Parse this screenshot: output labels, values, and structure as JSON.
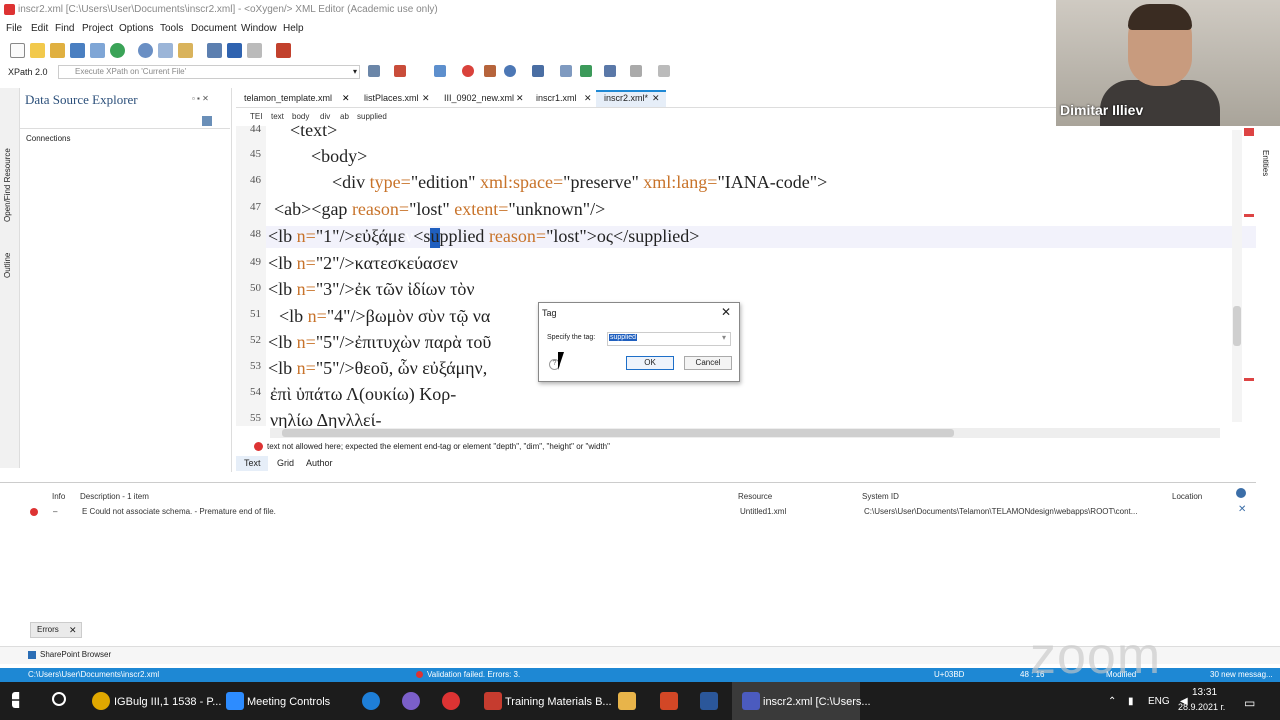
{
  "window": {
    "title": "inscr2.xml [C:\\Users\\User\\Documents\\inscr2.xml] - <oXygen/> XML Editor (Academic use only)"
  },
  "menu": [
    "File",
    "Edit",
    "Find",
    "Project",
    "Options",
    "Tools",
    "Document",
    "Window",
    "Help"
  ],
  "xpath": {
    "version": "XPath 2.0",
    "placeholder": "Execute XPath on 'Current File'"
  },
  "left_panel": {
    "title": "Data Source Explorer",
    "connections": "Connections",
    "vtab1": "Open/Find Resource",
    "vtab2": "Outline"
  },
  "tabs": [
    "telamon_template.xml",
    "listPlaces.xml",
    "III_0902_new.xml",
    "inscr1.xml",
    "inscr2.xml*"
  ],
  "breadcrumb": [
    "TEI",
    "text",
    "body",
    "div",
    "ab",
    "supplied"
  ],
  "lines": [
    {
      "n": "44",
      "parts": [
        [
          "k",
          "<text>"
        ]
      ]
    },
    {
      "n": "45",
      "parts": [
        [
          "k",
          "<body>"
        ]
      ]
    },
    {
      "n": "46",
      "parts": [
        [
          "k",
          "<div "
        ],
        [
          "a",
          "type="
        ],
        [
          "v",
          "\"edition\" "
        ],
        [
          "a",
          "xml:space="
        ],
        [
          "v",
          "\"preserve\" "
        ],
        [
          "a",
          "xml:lang="
        ],
        [
          "v",
          "\"IANA-code\">"
        ]
      ]
    },
    {
      "n": "47",
      "parts": [
        [
          "k",
          "<ab><gap "
        ],
        [
          "a",
          "reason="
        ],
        [
          "v",
          "\"lost\" "
        ],
        [
          "a",
          "extent="
        ],
        [
          "v",
          "\"unknown\"/>"
        ]
      ]
    },
    {
      "n": "48",
      "parts": [
        [
          "k",
          "<lb "
        ],
        [
          "a",
          "n="
        ],
        [
          "v",
          "\"1\"/>εὐξάμε"
        ],
        [
          "k",
          "ν"
        ],
        [
          "k",
          "<supplied "
        ],
        [
          "a",
          "reason="
        ],
        [
          "v",
          "\"lost\">ος</supplied>"
        ]
      ]
    },
    {
      "n": "49",
      "parts": [
        [
          "k",
          "<lb "
        ],
        [
          "a",
          "n="
        ],
        [
          "v",
          "\"2\"/>κατεσκεύασεν"
        ]
      ]
    },
    {
      "n": "50",
      "parts": [
        [
          "k",
          "<lb "
        ],
        [
          "a",
          "n="
        ],
        [
          "v",
          "\"3\"/>ἐκ τῶν ἰδίων τὸν"
        ]
      ]
    },
    {
      "n": "51",
      "parts": [
        [
          "k",
          "<lb "
        ],
        [
          "a",
          "n="
        ],
        [
          "v",
          "\"4\"/>βωμὸν σὺν τῷ να"
        ]
      ]
    },
    {
      "n": "52",
      "parts": [
        [
          "k",
          "<lb "
        ],
        [
          "a",
          "n="
        ],
        [
          "v",
          "\"5\"/>ἐπιτυχὼν παρὰ τοῦ"
        ]
      ]
    },
    {
      "n": "53",
      "parts": [
        [
          "k",
          "<lb "
        ],
        [
          "a",
          "n="
        ],
        [
          "v",
          "\"5\"/>θεοῦ, ὧν εὐξάμην,"
        ]
      ]
    },
    {
      "n": "54",
      "parts": [
        [
          "v",
          "ἐπὶ ὑπάτω Λ(ουκίω) Κορ-"
        ]
      ]
    },
    {
      "n": "55",
      "parts": [
        [
          "v",
          "νηλίω Δηνλλεί-"
        ]
      ]
    }
  ],
  "dialog": {
    "title": "Tag",
    "label": "Specify the tag:",
    "value": "supplied",
    "ok": "OK",
    "cancel": "Cancel"
  },
  "editor_error": "text not allowed here; expected the element end-tag or element \"depth\", \"dim\", \"height\" or \"width\"",
  "mode_tabs": [
    "Text",
    "Grid",
    "Author"
  ],
  "problems": {
    "headers": [
      "Info",
      "Description - 1 item",
      "Resource",
      "System ID",
      "Location"
    ],
    "row": {
      "info": "–",
      "description": "E Could not associate schema. - Premature end of file.",
      "resource": "Untitled1.xml",
      "system_id": "C:\\Users\\User\\Documents\\Telamon\\TELAMONdesign\\webapps\\ROOT\\cont..."
    },
    "tab": "Errors"
  },
  "share": "SharePoint Browser",
  "status": {
    "path": "C:\\Users\\User\\Documents\\inscr2.xml",
    "validation": "Validation failed. Errors: 3.",
    "unicode": "U+03BD",
    "pos": "48 : 16",
    "modified": "Modified",
    "messages": "30 new messag..."
  },
  "right_vtab": "Entities",
  "video": {
    "name": "Dimitar Illiev"
  },
  "taskbar": {
    "items": [
      "IGBulg III,1 1538 - P...",
      "Meeting Controls",
      "Training Materials B...",
      "inscr2.xml [C:\\Users..."
    ],
    "lang": "ENG",
    "time": "13:31",
    "date": "28.9.2021 г."
  },
  "zoom": "zoom",
  "colors": {
    "accent": "#1e88d4",
    "attr": "#c8732a",
    "selection": "#1f5fbf"
  }
}
